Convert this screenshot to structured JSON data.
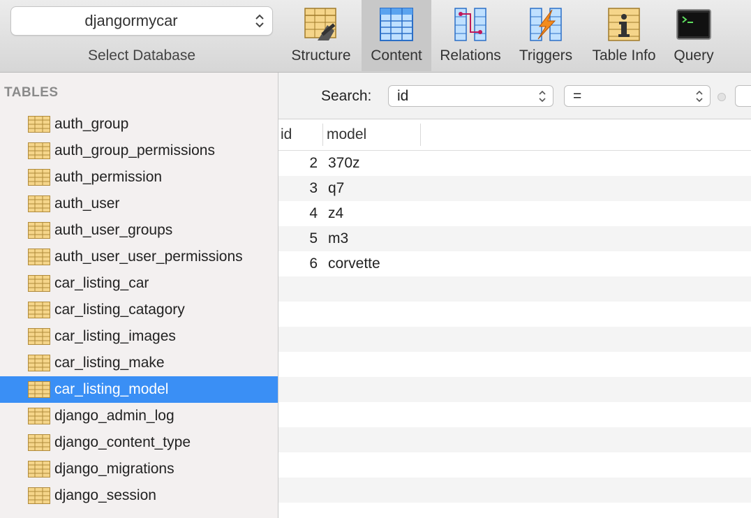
{
  "toolbar": {
    "database": "djangormycar",
    "database_label": "Select Database",
    "tools": [
      {
        "label": "Structure"
      },
      {
        "label": "Content"
      },
      {
        "label": "Relations"
      },
      {
        "label": "Triggers"
      },
      {
        "label": "Table Info"
      },
      {
        "label": "Query"
      }
    ],
    "active_tool": "Content"
  },
  "sidebar": {
    "heading": "TABLES",
    "tables": [
      "auth_group",
      "auth_group_permissions",
      "auth_permission",
      "auth_user",
      "auth_user_groups",
      "auth_user_user_permissions",
      "car_listing_car",
      "car_listing_catagory",
      "car_listing_images",
      "car_listing_make",
      "car_listing_model",
      "django_admin_log",
      "django_content_type",
      "django_migrations",
      "django_session"
    ],
    "selected": "car_listing_model"
  },
  "filter": {
    "label": "Search:",
    "field": "id",
    "operator": "="
  },
  "grid": {
    "columns": [
      "id",
      "model"
    ],
    "rows": [
      [
        "2",
        "370z"
      ],
      [
        "3",
        "q7"
      ],
      [
        "4",
        "z4"
      ],
      [
        "5",
        "m3"
      ],
      [
        "6",
        "corvette"
      ]
    ]
  },
  "colors": {
    "selection": "#3a8ff5",
    "sidebar_bg": "#f3f0f0",
    "toolbar_active": "#c8c8c8"
  }
}
